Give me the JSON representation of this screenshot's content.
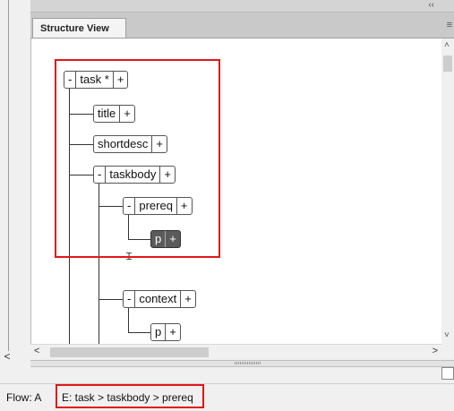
{
  "panel": {
    "tab_label": "Structure View",
    "collapse_glyph": "‹‹",
    "menu_glyph": "≡"
  },
  "tree": {
    "nodes": [
      {
        "name": "task",
        "label": "task *",
        "collapse": "-",
        "expand": "+"
      },
      {
        "name": "title",
        "label": "title",
        "expand": "+"
      },
      {
        "name": "shortdesc",
        "label": "shortdesc",
        "expand": "+"
      },
      {
        "name": "taskbody",
        "label": "taskbody",
        "collapse": "-",
        "expand": "+"
      },
      {
        "name": "prereq",
        "label": "prereq",
        "collapse": "-",
        "expand": "+"
      },
      {
        "name": "p",
        "label": "p",
        "expand": "+",
        "selected": true
      },
      {
        "name": "context",
        "label": "context",
        "collapse": "-",
        "expand": "+"
      },
      {
        "name": "p2",
        "label": "p",
        "expand": "+"
      }
    ]
  },
  "scrollbars": {
    "up": "˄",
    "down": "˅",
    "left": "<",
    "right": ">"
  },
  "left_arrow": "<",
  "statusbar": {
    "flow": "Flow: A",
    "element_path": "E: task > taskbody > prereq"
  }
}
